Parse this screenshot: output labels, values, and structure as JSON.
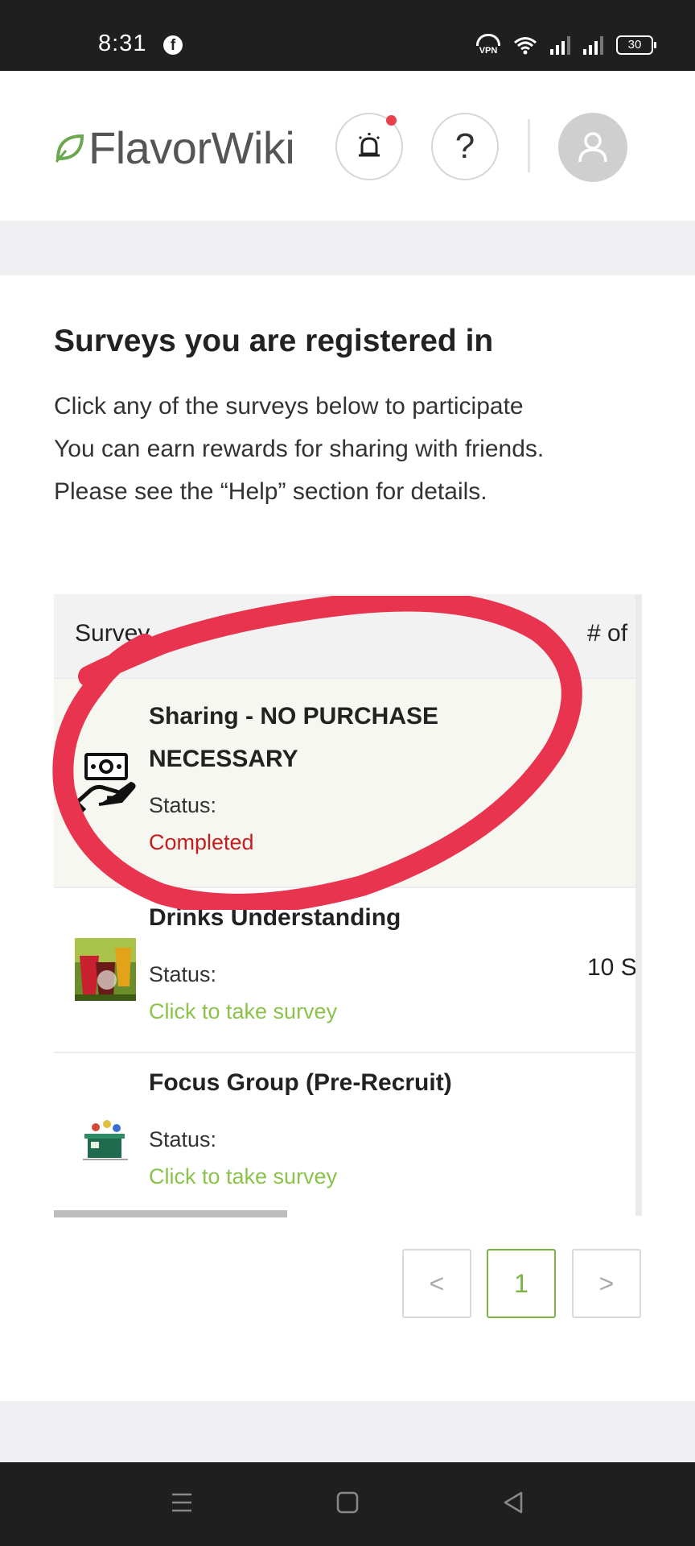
{
  "status_bar": {
    "time": "8:31",
    "vpn_label": "VPN",
    "battery": "30",
    "icons": [
      "facebook-icon",
      "vpn-icon",
      "wifi-icon",
      "signal-icon",
      "signal-icon",
      "battery-icon"
    ]
  },
  "header": {
    "logo_text": "FlavorWiki",
    "help_label": "?",
    "icons": [
      "leaf-logo-icon",
      "alarm-bell-icon",
      "help-icon",
      "user-avatar-icon"
    ],
    "notification_dot_color": "#e8414a"
  },
  "main": {
    "title": "Surveys you are registered in",
    "description_lines": [
      "Click any of the surveys below to participate",
      "You can earn rewards for sharing with friends.",
      "Please see the “Help” section for details."
    ]
  },
  "table": {
    "headers": [
      "Survey",
      "# of"
    ],
    "rows": [
      {
        "title_lines": [
          "Sharing - NO PURCHASE",
          "NECESSARY"
        ],
        "status_label": "Status:",
        "status_value": "Completed",
        "status_color": "#c41e1e",
        "number": "",
        "icon": "cash-hand-icon"
      },
      {
        "title_lines": [
          "Drinks Understanding"
        ],
        "status_label": "Status:",
        "status_value": "Click to take survey",
        "status_color": "#8bc34a",
        "number": "10 S",
        "icon": "drinks-thumbnail"
      },
      {
        "title_lines": [
          "Focus Group (Pre-Recruit)"
        ],
        "status_label": "Status:",
        "status_value": "Click to take survey",
        "status_color": "#8bc34a",
        "number": "",
        "icon": "focus-group-thumbnail"
      }
    ]
  },
  "pagination": {
    "prev": "<",
    "current": "1",
    "next": ">",
    "accent": "#7cb342"
  },
  "nav_bar": {
    "icons": [
      "menu-icon",
      "home-icon",
      "back-icon"
    ]
  },
  "annotation": {
    "color": "#e8344f",
    "shape": "hand-drawn circle around first survey row"
  }
}
